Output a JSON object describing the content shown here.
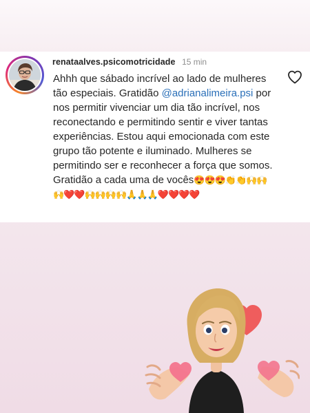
{
  "comment": {
    "username": "renataalves.psicomotricidade",
    "time": "15 min",
    "text_before_mention": "Ahhh que sábado incrível ao lado de mulheres tão especiais. Gratidão ",
    "mention": "@adrianalimeira.psi",
    "text_after_mention": " por nos permitir vivenciar um dia tão incrível, nos reconectando e permitindo sentir e viver tantas experiências.  Estou aqui emocionada com este grupo tão potente e iluminado.  Mulheres se permitindo ser e reconhecer a força que somos.  Gratidão a cada uma de vocês",
    "emojis": "😍😍😍👏👏🙌🙌🙌❤️❤️🙌🙌🙌🙌🙏🙏🙏❤️❤️❤️❤️"
  },
  "colors": {
    "mention": "#2a6fb8",
    "username": "#262626",
    "time": "#8e8e8e"
  },
  "icons": {
    "like": "heart-outline-icon"
  }
}
